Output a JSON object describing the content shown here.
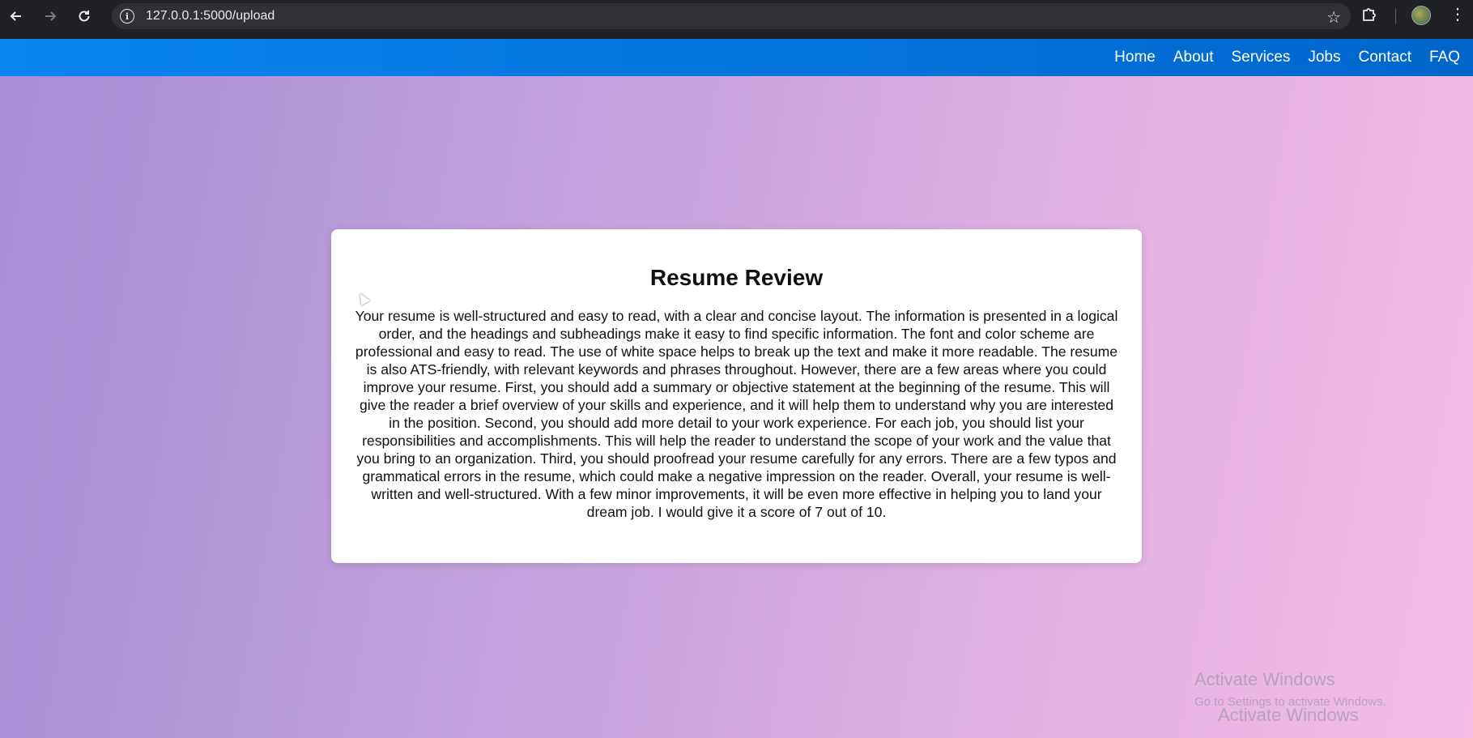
{
  "browser": {
    "url": "127.0.0.1:5000/upload",
    "icons": {
      "back": "arrow-left",
      "forward": "arrow-right",
      "reload": "reload",
      "info": "info",
      "bookmark": "star",
      "extensions": "puzzle",
      "menu": "kebab"
    }
  },
  "nav": {
    "items": [
      "Home",
      "About",
      "Services",
      "Jobs",
      "Contact",
      "FAQ"
    ]
  },
  "review": {
    "title": "Resume Review",
    "body": "Your resume is well-structured and easy to read, with a clear and concise layout. The information is presented in a logical order, and the headings and subheadings make it easy to find specific information. The font and color scheme are professional and easy to read. The use of white space helps to break up the text and make it more readable. The resume is also ATS-friendly, with relevant keywords and phrases throughout. However, there are a few areas where you could improve your resume. First, you should add a summary or objective statement at the beginning of the resume. This will give the reader a brief overview of your skills and experience, and it will help them to understand why you are interested in the position. Second, you should add more detail to your work experience. For each job, you should list your responsibilities and accomplishments. This will help the reader to understand the scope of your work and the value that you bring to an organization. Third, you should proofread your resume carefully for any errors. There are a few typos and grammatical errors in the resume, which could make a negative impression on the reader. Overall, your resume is well-written and well-structured. With a few minor improvements, it will be even more effective in helping you to land your dream job. I would give it a score of 7 out of 10."
  },
  "watermark": {
    "title": "Activate Windows",
    "subtitle": "Go to Settings to activate Windows.",
    "title_repeat": "Activate Windows"
  },
  "colors": {
    "nav_gradient_start": "#0a84f0",
    "nav_gradient_end": "#0066cc",
    "page_gradient_start": "#a58ed6",
    "page_gradient_end": "#f3bde8"
  }
}
